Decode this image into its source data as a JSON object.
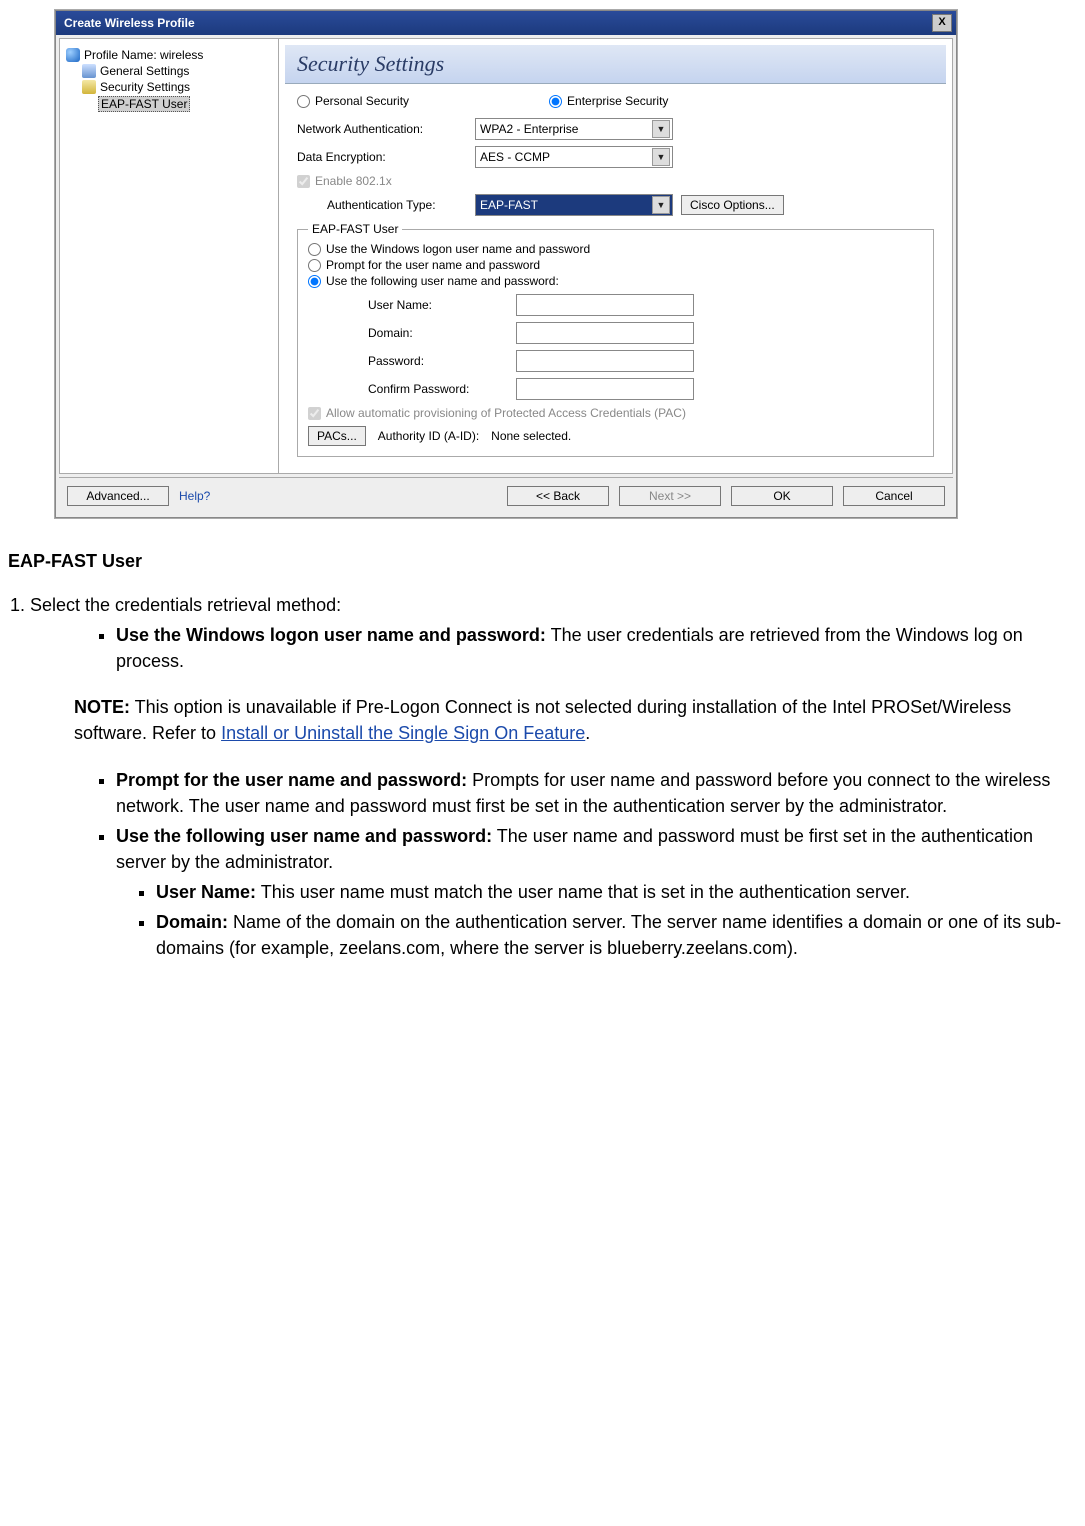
{
  "dialog": {
    "title": "Create Wireless Profile",
    "close_glyph": "X",
    "nav": {
      "profile_label": "Profile Name: wireless",
      "general_label": "General Settings",
      "security_label": "Security Settings",
      "eap_label": "EAP-FAST User"
    },
    "banner": "Security Settings",
    "sec_radio_personal": "Personal Security",
    "sec_radio_enterprise": "Enterprise Security",
    "netauth_label": "Network Authentication:",
    "netauth_value": "WPA2 - Enterprise",
    "dataenc_label": "Data Encryption:",
    "dataenc_value": "AES - CCMP",
    "enable8021x_label": "Enable 802.1x",
    "authtype_label": "Authentication Type:",
    "authtype_value": "EAP-FAST",
    "cisco_btn": "Cisco Options...",
    "fieldset_legend": "EAP-FAST User",
    "opt_windows": "Use the Windows logon user name and password",
    "opt_prompt": "Prompt for the user name and password",
    "opt_following": "Use the following user name and password:",
    "cred_user_label": "User Name:",
    "cred_domain_label": "Domain:",
    "cred_pass_label": "Password:",
    "cred_confirm_label": "Confirm Password:",
    "allow_pac_label": "Allow automatic provisioning of Protected Access Credentials (PAC)",
    "pacs_btn": "PACs...",
    "authid_label": "Authority ID (A-ID):",
    "authid_value": "None selected.",
    "footer": {
      "advanced": "Advanced...",
      "help": "Help?",
      "back": "<< Back",
      "next": "Next >>",
      "ok": "OK",
      "cancel": "Cancel"
    }
  },
  "doc": {
    "heading": "EAP-FAST User",
    "step1_intro": "Select the credentials retrieval method:",
    "b1_strong": "Use the Windows logon user name and password:",
    "b1_text": " The user credentials are retrieved from the Windows log on process.",
    "note_strong": "NOTE:",
    "note_text_a": " This option is unavailable if Pre-Logon Connect is not selected during installation of the Intel PROSet/Wireless software. Refer to ",
    "note_link": "Install or Uninstall the Single Sign On Feature",
    "note_text_b": ".",
    "b2_strong": "Prompt for the user name and password:",
    "b2_text": " Prompts for user name and password before you connect to the wireless network. The user name and password must first be set in the authentication server by the administrator.",
    "b3_strong": "Use the following user name and password:",
    "b3_text": " The user name and password must be first set in the authentication server by the administrator.",
    "s1_strong": "User Name:",
    "s1_text": " This user name must match the user name that is set in the authentication server.",
    "s2_strong": "Domain:",
    "s2_text": " Name of the domain on the authentication server. The server name identifies a domain or one of its sub-domains (for example, zeelans.com, where the server is blueberry.zeelans.com)."
  }
}
